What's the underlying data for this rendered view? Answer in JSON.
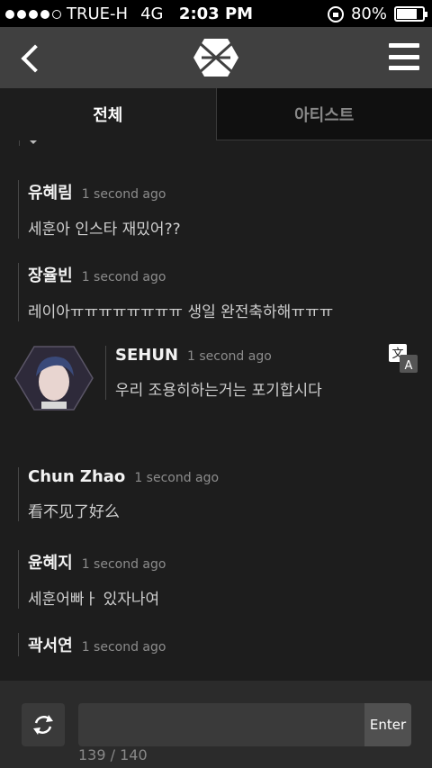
{
  "status_bar": {
    "carrier": "TRUE-H",
    "network": "4G",
    "time": "2:03 PM",
    "battery": "80%",
    "battery_level": 0.8,
    "signal_dots": 4,
    "signal_total": 5
  },
  "header": {
    "back_icon": "chevron-left-icon",
    "logo_icon": "exo-logo",
    "menu_icon": "hamburger-icon"
  },
  "tabs": [
    {
      "label": "전체",
      "active": true
    },
    {
      "label": "아티스트",
      "active": false
    }
  ],
  "messages": [
    {
      "name": "유혜림",
      "time": "1 second ago",
      "text": "세훈아 인스타 재밌어??"
    },
    {
      "name": "장율빈",
      "time": "1 second ago",
      "text": "레이아ㅠㅠㅠㅠㅠㅠㅠㅠ 생일 완전축하해ㅠㅠㅠ"
    },
    {
      "name": "SEHUN",
      "time": "1 second ago",
      "text": "우리 조용히하는거는 포기합시다",
      "artist": true
    },
    {
      "name": "Chun Zhao",
      "time": "1 second ago",
      "text": "看不见了好么"
    },
    {
      "name": "윤혜지",
      "time": "1 second ago",
      "text": "세훈어빠ㅏ 있자나여"
    },
    {
      "name": "곽서연",
      "time": "1 second ago",
      "text": ""
    }
  ],
  "input": {
    "value": "",
    "placeholder": "",
    "enter_label": "Enter",
    "char_count": "139 / 140"
  },
  "colors": {
    "background": "#1d1d1d",
    "header": "#404040",
    "input_bar": "#2b2b2b"
  }
}
